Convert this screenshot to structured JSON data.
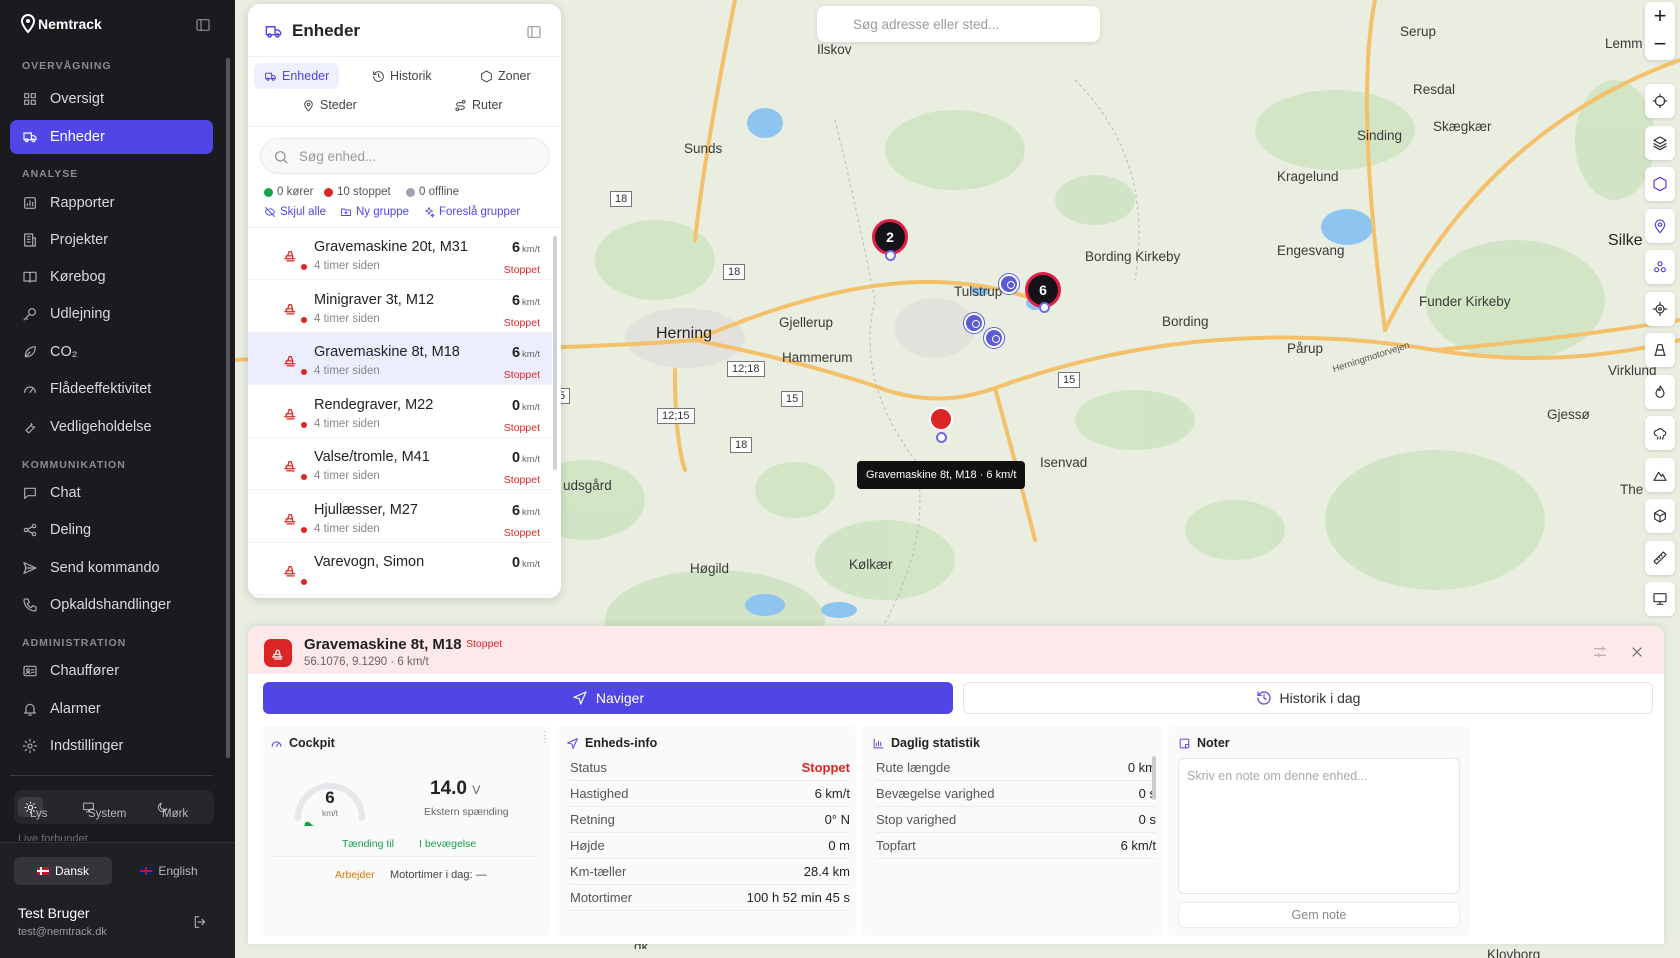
{
  "app": {
    "brand": "Nemtrack"
  },
  "nav": {
    "sections": {
      "monitoring": "OVERVÅGNING",
      "analysis": "ANALYSE",
      "communication": "KOMMUNIKATION",
      "administration": "ADMINISTRATION"
    },
    "items": [
      {
        "label": "Oversigt",
        "icon": "grid-icon"
      },
      {
        "label": "Enheder",
        "icon": "truck-icon",
        "active": true
      },
      {
        "label": "Rapporter",
        "icon": "report-icon"
      },
      {
        "label": "Projekter",
        "icon": "building-icon"
      },
      {
        "label": "Kørebog",
        "icon": "book-icon"
      },
      {
        "label": "Udlejning",
        "icon": "key-icon"
      },
      {
        "label": "CO₂",
        "icon": "leaf-icon"
      },
      {
        "label": "Flådeeffektivitet",
        "icon": "gauge-icon"
      },
      {
        "label": "Vedligeholdelse",
        "icon": "wrench-icon"
      },
      {
        "label": "Chat",
        "icon": "chat-icon"
      },
      {
        "label": "Deling",
        "icon": "share-icon"
      },
      {
        "label": "Send kommando",
        "icon": "send-icon"
      },
      {
        "label": "Opkaldshandlinger",
        "icon": "phone-icon"
      },
      {
        "label": "Chauffører",
        "icon": "id-card-icon"
      },
      {
        "label": "Alarmer",
        "icon": "bell-icon"
      },
      {
        "label": "Indstillinger",
        "icon": "gear-icon"
      }
    ],
    "theme": {
      "light": "Lys",
      "system": "System",
      "dark": "Mørk"
    },
    "live": "Live forbundet",
    "lang": {
      "da": "Dansk",
      "en": "English"
    },
    "user": {
      "name": "Test Bruger",
      "email": "test@nemtrack.dk"
    }
  },
  "map": {
    "search_placeholder": "Søg adresse eller sted...",
    "towns": [
      "Ilskov",
      "Serup",
      "Lemm",
      "Resdal",
      "Sinding",
      "Skægkær",
      "Sunds",
      "Kragelund",
      "Silke",
      "Bording Kirkeby",
      "Engesvang",
      "Tulstrup",
      "Herning",
      "Gjellerup",
      "Funder Kirkeby",
      "Bording",
      "Hammerum",
      "Pårup",
      "Virklund",
      "Herningmotorvejen",
      "Gjessø",
      "Isenvad",
      "The",
      "udsgård",
      "Høgild",
      "Kølkær",
      "Klovborg",
      "dk"
    ],
    "roads": [
      "18",
      "18",
      "12;18",
      "15",
      "15",
      "12;15",
      "18",
      "5"
    ],
    "clusters": [
      "2",
      "6"
    ],
    "tooltip": "Gravemaskine 8t, M18 · 6 km/t"
  },
  "panel": {
    "title": "Enheder",
    "tabs": [
      "Enheder",
      "Historik",
      "Zoner",
      "Steder",
      "Ruter"
    ],
    "search_placeholder": "Søg enhed...",
    "stats": {
      "driving": "0 kører",
      "stopped": "10 stoppet",
      "offline": "0 offline"
    },
    "actions": {
      "hide": "Skjul alle",
      "new_group": "Ny gruppe",
      "suggest": "Foreslå grupper"
    },
    "colors": {
      "driving": "#16a34a",
      "stopped": "#dc2626",
      "offline": "#9ca3af",
      "accent": "#4f46e5"
    },
    "unit": "km/t",
    "devices": [
      {
        "name": "Gravemaskine 20t, M31",
        "ago": "4 timer siden",
        "speed": "6",
        "status": "Stoppet"
      },
      {
        "name": "Minigraver 3t, M12",
        "ago": "4 timer siden",
        "speed": "6",
        "status": "Stoppet"
      },
      {
        "name": "Gravemaskine 8t, M18",
        "ago": "4 timer siden",
        "speed": "6",
        "status": "Stoppet",
        "selected": true
      },
      {
        "name": "Rendegraver, M22",
        "ago": "4 timer siden",
        "speed": "0",
        "status": "Stoppet"
      },
      {
        "name": "Valse/tromle, M41",
        "ago": "4 timer siden",
        "speed": "0",
        "status": "Stoppet"
      },
      {
        "name": "Hjullæsser, M27",
        "ago": "4 timer siden",
        "speed": "6",
        "status": "Stoppet"
      },
      {
        "name": "Varevogn, Simon",
        "ago": "",
        "speed": "0",
        "status": ""
      }
    ]
  },
  "detail": {
    "name": "Gravemaskine 8t, M18",
    "badge": "Stoppet",
    "sub": "56.1076, 9.1290 · 6 km/t",
    "navigate": "Naviger",
    "history": "Historik i dag",
    "cockpit": {
      "title": "Cockpit",
      "speed": "6",
      "speed_fraction": 0.05,
      "speed_unit": "km/t",
      "voltage": "14.0",
      "voltage_unit": "V",
      "voltage_label": "Ekstern spænding",
      "ignition": "Tænding til",
      "moving": "I bevægelse",
      "working": "Arbejder",
      "engine_today": "Motortimer i dag: —"
    },
    "info": {
      "title": "Enheds-info",
      "rows": [
        {
          "k": "Status",
          "v": "Stoppet"
        },
        {
          "k": "Hastighed",
          "v": "6 km/t"
        },
        {
          "k": "Retning",
          "v": "0° N"
        },
        {
          "k": "Højde",
          "v": "0 m"
        },
        {
          "k": "Km-tæller",
          "v": "28.4 km"
        },
        {
          "k": "Motortimer",
          "v": "100 h 52 min 45 s"
        }
      ]
    },
    "daily": {
      "title": "Daglig statistik",
      "rows": [
        {
          "k": "Rute længde",
          "v": "0 km"
        },
        {
          "k": "Bevægelse varighed",
          "v": "0 s"
        },
        {
          "k": "Stop varighed",
          "v": "0 s"
        },
        {
          "k": "Topfart",
          "v": "6 km/t"
        }
      ]
    },
    "notes": {
      "title": "Noter",
      "placeholder": "Skriv en note om denne enhed...",
      "save": "Gem note"
    }
  }
}
